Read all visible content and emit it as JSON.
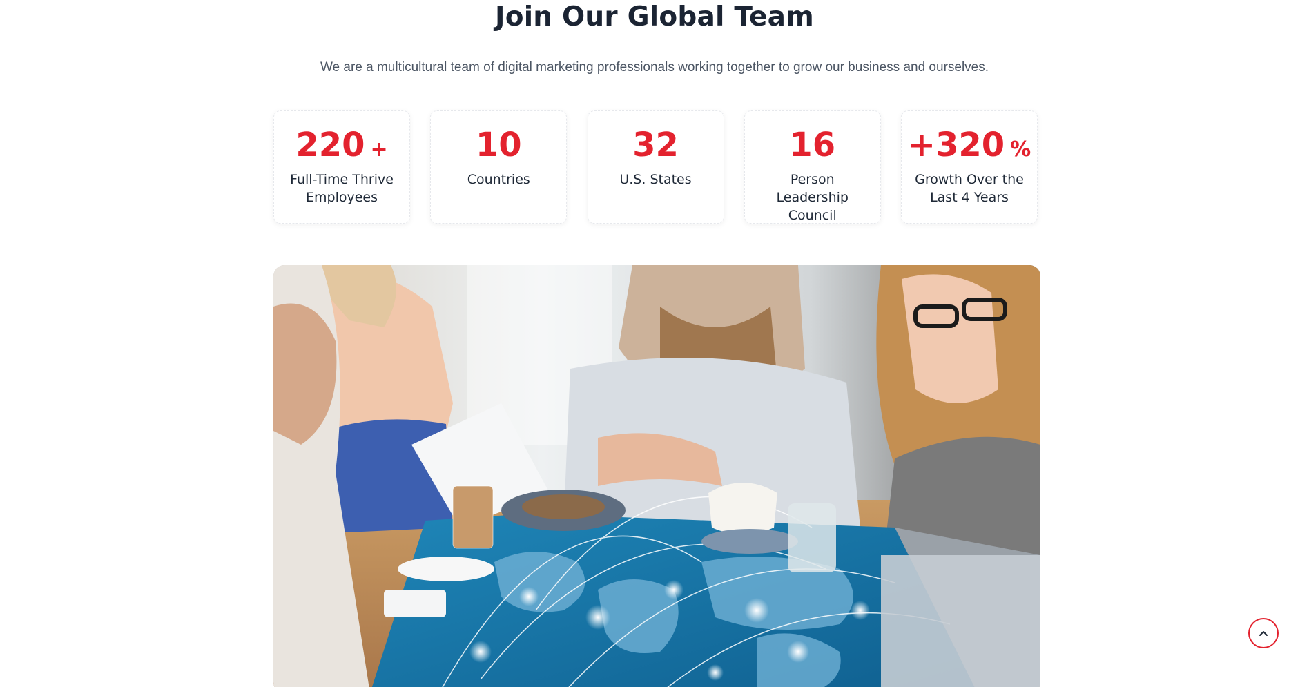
{
  "section": {
    "title": "Join Our Global Team",
    "intro": "We are a multicultural team of digital marketing professionals working together to grow our business and ourselves."
  },
  "stats": [
    {
      "value": "220",
      "suffix": "+",
      "label": "Full-Time Thrive Employees"
    },
    {
      "value": "10",
      "suffix": "",
      "label": "Countries"
    },
    {
      "value": "32",
      "suffix": "",
      "label": "U.S. States"
    },
    {
      "value": "16",
      "suffix": "",
      "label": "Person Leadership Council"
    },
    {
      "value": "+320",
      "suffix": "%",
      "label": "Growth Over the Last 4 Years"
    }
  ],
  "colors": {
    "accent": "#e3222e",
    "heading": "#1b2433",
    "body_text": "#4b5563",
    "card_border": "#e6e8ec"
  },
  "icons": {
    "scroll_top": "chevron-up-icon"
  }
}
